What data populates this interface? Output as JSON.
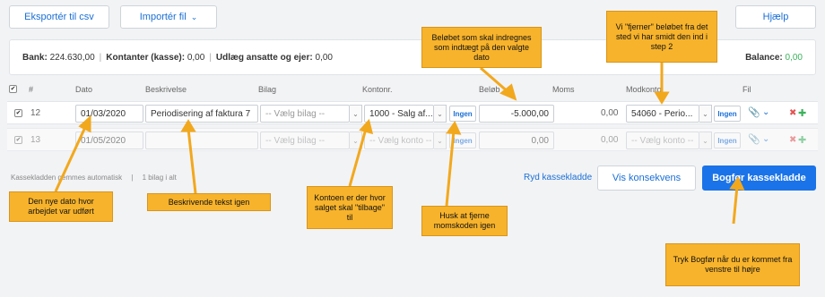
{
  "toolbar": {
    "export_label": "Eksportér til csv",
    "import_label": "Importér fil",
    "import_caret": "⌄",
    "help_label": "Hjælp"
  },
  "summary": {
    "bank_label": "Bank:",
    "bank_value": "224.630,00",
    "cash_label": "Kontanter (kasse):",
    "cash_value": "0,00",
    "expenses_label": "Udlæg ansatte og ejer:",
    "expenses_value": "0,00",
    "balance_label": "Balance:",
    "balance_value": "0,00",
    "separator": "|"
  },
  "table": {
    "headers": {
      "num": "#",
      "date": "Dato",
      "description": "Beskrivelse",
      "attachment": "Bilag",
      "account": "Kontonr.",
      "amount": "Beløb",
      "vat": "Moms",
      "counter": "Modkonto",
      "file": "Fil"
    },
    "rows": [
      {
        "num": "12",
        "date": "01/03/2020",
        "description": "Periodisering af faktura 7",
        "attachment": "-- Vælg bilag --",
        "account": "1000 - Salg af...",
        "vat_code": "Ingen",
        "amount": "-5.000,00",
        "vat": "0,00",
        "counter": "54060 - Perio...",
        "counter_vat": "Ingen"
      },
      {
        "num": "13",
        "date": "01/05/2020",
        "description": "",
        "attachment": "-- Vælg bilag --",
        "account": "-- Vælg konto --",
        "vat_code": "Ingen",
        "amount": "0,00",
        "vat": "0,00",
        "counter": "-- Vælg konto --",
        "counter_vat": "Ingen"
      }
    ]
  },
  "footer": {
    "autosave_text": "Kassekladden gemmes automatisk",
    "separator": "|",
    "count_text": "1 bilag i alt",
    "clear_link": "Ryd kassekladde",
    "show_effect_label": "Vis konsekvens",
    "book_label": "Bogfør kassekladde"
  },
  "annotations": {
    "amount_note": "Beløbet som skal indregnes som indtægt på den valgte dato",
    "counter_note": "Vi \"fjerner\" beløbet fra det sted vi har smidt den ind i step 2",
    "date_note": "Den nye dato hvor arbejdet var udført",
    "description_note": "Beskrivende tekst igen",
    "account_note": "Kontoen er der hvor salget skal \"tilbage\" til",
    "vat_note": "Husk at fjerne momskoden igen",
    "book_note": "Tryk Bogfør når du er kommet fra venstre til højre"
  },
  "icons": {
    "paperclip": "📎",
    "chevron": "⌄",
    "delete": "✖",
    "add": "✚",
    "check": "✔"
  },
  "colors": {
    "accent": "#1a73e8",
    "note": "#f7b32b",
    "balance_green": "#3bb25b",
    "delete_red": "#e55353",
    "add_green": "#3bb25b"
  }
}
